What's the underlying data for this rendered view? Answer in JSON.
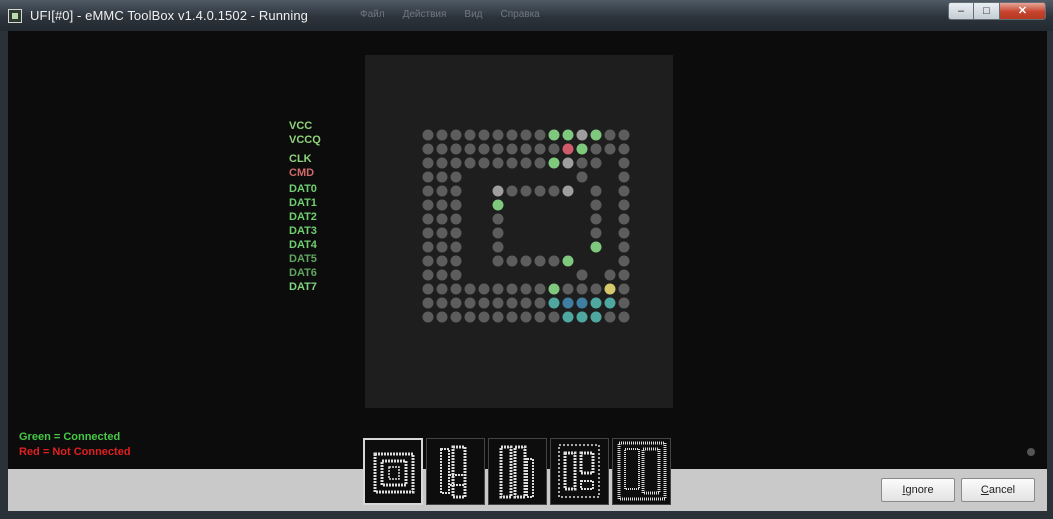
{
  "window": {
    "title": "UFI[#0] - eMMC ToolBox v1.4.0.1502 - Running",
    "ghost_menu": [
      "Файл",
      "Действия",
      "Вид",
      "Справка"
    ],
    "controls": {
      "minimize": "–",
      "maximize": "□",
      "close": "✕"
    }
  },
  "pins": [
    {
      "label": "VCC",
      "status": "connected",
      "color": "#8ed37a"
    },
    {
      "label": "VCCQ",
      "status": "connected",
      "color": "#8ed37a"
    },
    {
      "label": "CLK",
      "status": "connected",
      "color": "#8ed37a"
    },
    {
      "label": "CMD",
      "status": "not-connected",
      "color": "#d26a6a"
    },
    {
      "label": "DAT0",
      "status": "connected",
      "color": "#6fcf6f"
    },
    {
      "label": "DAT1",
      "status": "connected",
      "color": "#6fcf6f"
    },
    {
      "label": "DAT2",
      "status": "connected",
      "color": "#6fcf6f"
    },
    {
      "label": "DAT3",
      "status": "connected",
      "color": "#6fcf6f"
    },
    {
      "label": "DAT4",
      "status": "connected",
      "color": "#6fcf6f"
    },
    {
      "label": "DAT5",
      "status": "connected",
      "color": "#5fa65f"
    },
    {
      "label": "DAT6",
      "status": "connected",
      "color": "#5fa65f"
    },
    {
      "label": "DAT7",
      "status": "connected",
      "color": "#7fd47f"
    }
  ],
  "ball_grid": {
    "rows": [
      "GGGGGGGGGAALAGG",
      "GGGGGGGGGGRAGGG",
      "GGGGGGGGGALGG.G",
      "GGG........G..G",
      "GGG..LGGGGL.G.G",
      "GGG..A......G.G",
      "GGG..G......G.G",
      "GGG..G......G.G",
      "GGG..G......A.G",
      "GGG..GGGGGA...G",
      "GGG........G.GG",
      "GGGGGGGGGAGGGYG",
      "GGGGGGGGGTBBTTG",
      "GGGGGGGGGGTTTGG"
    ],
    "colors": {
      "G": "#5d5d5d",
      "L": "#9e9e9e",
      "A": "#7fc97f",
      "R": "#cf5b6b",
      "T": "#4fa8a0",
      "B": "#3f7ea0",
      "Y": "#d4c86a"
    }
  },
  "legend": {
    "connected": "Green = Connected",
    "not_connected": "Red = Not Connected",
    "connected_color": "#46c846",
    "not_connected_color": "#e02020"
  },
  "buttons": {
    "ignore": "Ignore",
    "cancel": "Cancel"
  }
}
